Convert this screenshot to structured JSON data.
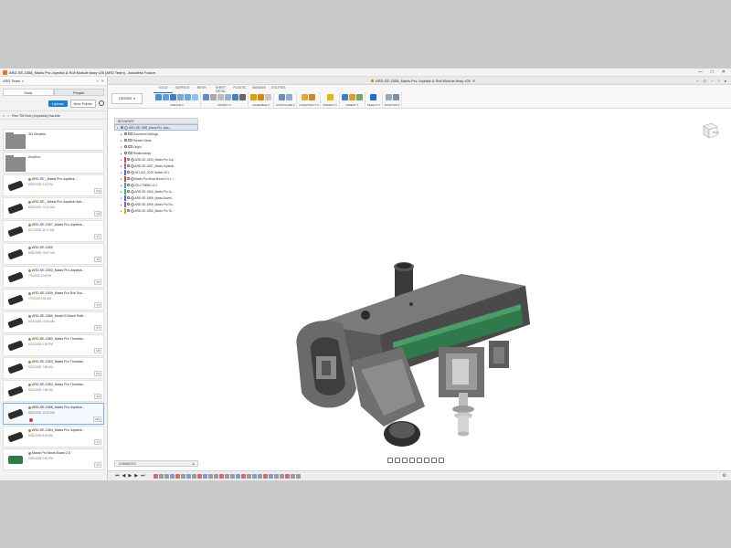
{
  "window": {
    "title": "ARD-SE-1558_Maxis Pro Joystick & Roll Module Assy v26 (ARD Team) - Autodesk Fusion",
    "controls": [
      "—",
      "□",
      "✕"
    ]
  },
  "data_panel": {
    "team": "ARD Team",
    "tabs": [
      "Data",
      "People"
    ],
    "upload_label": "Upload",
    "new_folder_label": "New Folder",
    "breadcrumb": "Pan Tilt Roll (Joystick) Handle",
    "folders": [
      {
        "name": "3D Models"
      },
      {
        "name": "Archive"
      }
    ],
    "files": [
      {
        "title": "ARD-SE-_Maxis Pro Joystick ...",
        "date": "8/30/2025 2:14 PM",
        "version": "V4"
      },
      {
        "title": "ARD-SE-_Maxis Pro Joystick Han...",
        "date": "8/30/2025 10:13 AM",
        "version": "V3"
      },
      {
        "title": "ARD-SE-1557_Maxis Pro Joystick...",
        "date": "8/17/2025 11:37 AM",
        "version": "V7"
      },
      {
        "title": "ARD-SE-1505",
        "date": "8/30/2025 10:07 AM",
        "version": "V2"
      },
      {
        "title": "ARD-SE-1503_Maxis Pro Joystick...",
        "date": "7/7/2025 3:18 PM",
        "version": "V9"
      },
      {
        "title": "ARD-SE-1509_Maxis Pro Roll Suc...",
        "date": "7/7/2025 9:51 AM",
        "version": "V4"
      },
      {
        "title": "ARD-SE-1569_Model 5 Dutch Rollt...",
        "date": "6/14/2025 10:30 AM",
        "version": "V7"
      },
      {
        "title": "ARD-SE-1552_Maxis Pro Thumbw...",
        "date": "6/23/2025 2:36 PM",
        "version": "V8"
      },
      {
        "title": "ARD-SE-1553_Maxis Pro Thumbw...",
        "date": "5/31/2025 7:56 AM",
        "version": "V2"
      },
      {
        "title": "ARD-SE-1554_Maxis Pro Thumbw...",
        "date": "5/31/2025 7:58 AM",
        "version": "V1"
      },
      {
        "title": "ARD-SE-1558_Maxis Pro Joystick...",
        "date": "8/30/2025 10:23 AM",
        "version": "V26"
      },
      {
        "title": "ARD-SE-1564_Maxis Pro Joystick...",
        "date": "8/30/2025 8:04 AM",
        "version": "V1"
      },
      {
        "title": "Maxis Pro Mock Board 2.0",
        "date": "6/30/2025 2:55 PM",
        "version": "V1"
      }
    ]
  },
  "document_tab": {
    "label": "ARD-SE-1558_Maxis Pro Joystick & Roll Module Assy v26"
  },
  "toolbar": {
    "workspace": "DESIGN",
    "tabs": [
      "SOLID",
      "SURFACE",
      "MESH",
      "SHEET METAL",
      "PLASTIC",
      "MANAGE",
      "UTILITIES"
    ],
    "groups": [
      {
        "label": "CREATE ▾",
        "icon_names": [
          "new-component-icon",
          "extrude-icon",
          "revolve-icon",
          "hole-icon",
          "pattern-icon",
          "mirror-icon"
        ],
        "colors": [
          "#4a90d9",
          "#5aa0e6",
          "#3c7fc6",
          "#7fa6cf",
          "#6aa8e0",
          "#8fc1ef"
        ]
      },
      {
        "label": "MODIFY ▾",
        "icon_names": [
          "press-pull-icon",
          "fillet-icon",
          "chamfer-icon",
          "shell-icon",
          "combine-icon",
          "move-icon"
        ],
        "colors": [
          "#5f8fc2",
          "#a9a9a9",
          "#bcbcbc",
          "#8db5db",
          "#4b7fb8",
          "#666666"
        ]
      },
      {
        "label": "ASSEMBLE ▾",
        "icon_names": [
          "joint-icon",
          "as-built-icon",
          "motion-icon"
        ],
        "colors": [
          "#e0a400",
          "#d98b00",
          "#c5c5c5"
        ]
      },
      {
        "label": "CONFIGURE ▾",
        "icon_names": [
          "configure-icon",
          "table-icon"
        ],
        "colors": [
          "#6b8fb5",
          "#8aaed3"
        ]
      },
      {
        "label": "CONSTRUCT ▾",
        "icon_names": [
          "plane-icon",
          "axis-icon"
        ],
        "colors": [
          "#e8a53a",
          "#c98a2a"
        ]
      },
      {
        "label": "INSPECT ▾",
        "icon_names": [
          "measure-icon"
        ],
        "colors": [
          "#e6b800"
        ]
      },
      {
        "label": "INSERT ▾",
        "icon_names": [
          "insert-icon",
          "decal-icon",
          "canvas-icon"
        ],
        "colors": [
          "#3a7fc9",
          "#e29a2d",
          "#6ca96c"
        ]
      },
      {
        "label": "SELECT ▾",
        "icon_names": [
          "select-icon"
        ],
        "colors": [
          "#1c6fd1"
        ]
      },
      {
        "label": "POSITION ▾",
        "icon_names": [
          "capture-position-icon",
          "revert-icon"
        ],
        "colors": [
          "#9aa9b8",
          "#7e8fa0"
        ]
      }
    ]
  },
  "browser": {
    "header": "BROWSER",
    "root": "ARD-SE-1558_Maxis Pro Joys...",
    "nodes": [
      {
        "label": "Document Settings",
        "type": "settings",
        "color": ""
      },
      {
        "label": "Named Views",
        "type": "folder",
        "color": ""
      },
      {
        "label": "Origin",
        "type": "folder",
        "color": ""
      },
      {
        "label": "Relationships",
        "type": "folder",
        "color": ""
      },
      {
        "label": "ARD-SE-1503_Maxis Pro Joy...",
        "type": "component",
        "color": "#d64545"
      },
      {
        "label": "ARD-SE-1557_Maxis Joystick...",
        "type": "component",
        "color": "#c64bc6"
      },
      {
        "label": "SKI-100_2019 Switch v3:1",
        "type": "component",
        "color": "#3a6fd8"
      },
      {
        "label": "Maxis Pro Mock Board 2.0 v...",
        "type": "component",
        "color": "#d64545"
      },
      {
        "label": "SS-CTNB50-v2:1",
        "type": "component",
        "color": "#3aa0d8"
      },
      {
        "label": "ARD-SE-1564_Maxis Pro Jo...",
        "type": "component",
        "color": "#3ab86a"
      },
      {
        "label": "ARD-SE-1569_Maxis Dovetl...",
        "type": "component",
        "color": "#3a6fd8"
      },
      {
        "label": "ARD-SE-1509_Maxis Pro Ro...",
        "type": "component",
        "color": "#8a5ad8"
      },
      {
        "label": "ARD-SE-1552_Maxis Pro Th...",
        "type": "component",
        "color": "#d8a53a"
      }
    ]
  },
  "comments_label": "COMMENTS",
  "viewcube_face": "BACK",
  "timeline": {
    "operation_count": 27
  }
}
